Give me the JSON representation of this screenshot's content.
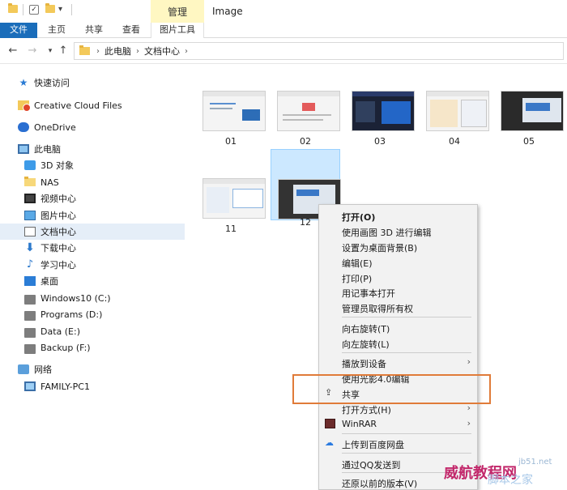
{
  "title_bar": {
    "manage_tab": "管理",
    "window_title": "Image"
  },
  "ribbon": {
    "tabs": [
      "文件",
      "主页",
      "共享",
      "查看",
      "图片工具"
    ]
  },
  "address": {
    "crumbs": [
      "此电脑",
      "文档中心"
    ]
  },
  "sidebar": {
    "items": [
      {
        "label": "快速访问",
        "icon": "quick-access-star-icon"
      },
      {
        "label": "Creative Cloud Files",
        "icon": "creative-cloud-icon"
      },
      {
        "label": "OneDrive",
        "icon": "onedrive-cloud-icon"
      },
      {
        "label": "此电脑",
        "icon": "this-pc-icon"
      },
      {
        "label": "3D 对象",
        "icon": "3d-objects-icon"
      },
      {
        "label": "NAS",
        "icon": "folder-icon"
      },
      {
        "label": "视频中心",
        "icon": "video-icon"
      },
      {
        "label": "图片中心",
        "icon": "pictures-icon"
      },
      {
        "label": "文档中心",
        "icon": "documents-icon"
      },
      {
        "label": "下载中心",
        "icon": "download-icon"
      },
      {
        "label": "学习中心",
        "icon": "music-icon"
      },
      {
        "label": "桌面",
        "icon": "desktop-icon"
      },
      {
        "label": "Windows10 (C:)",
        "icon": "drive-icon"
      },
      {
        "label": "Programs (D:)",
        "icon": "drive-icon"
      },
      {
        "label": "Data (E:)",
        "icon": "drive-icon"
      },
      {
        "label": "Backup (F:)",
        "icon": "drive-icon"
      },
      {
        "label": "网络",
        "icon": "network-icon"
      },
      {
        "label": "FAMILY-PC1",
        "icon": "computer-icon"
      }
    ],
    "selected": "文档中心"
  },
  "files": [
    {
      "name": "01"
    },
    {
      "name": "02"
    },
    {
      "name": "03"
    },
    {
      "name": "04"
    },
    {
      "name": "05"
    },
    {
      "name": "11"
    },
    {
      "name": "12"
    }
  ],
  "selected_file": "12",
  "context_menu": {
    "items": [
      "打开(O)",
      "使用画图 3D 进行编辑",
      "设置为桌面背景(B)",
      "编辑(E)",
      "打印(P)",
      "用记事本打开",
      "管理员取得所有权",
      "向右旋转(T)",
      "向左旋转(L)",
      "播放到设备",
      "使用光影4.0编辑",
      "共享",
      "打开方式(H)",
      "WinRAR",
      "上传到百度网盘",
      "通过QQ发送到",
      "还原以前的版本(V)"
    ]
  },
  "watermark": {
    "text1": "威航教程网",
    "text2": "脚本之家",
    "text3": "jb51.net"
  },
  "colors": {
    "file_tab": "#1a6dba",
    "manage_tab": "#fff7c2",
    "selection": "#cce8ff",
    "highlight_box": "#e07b39"
  }
}
